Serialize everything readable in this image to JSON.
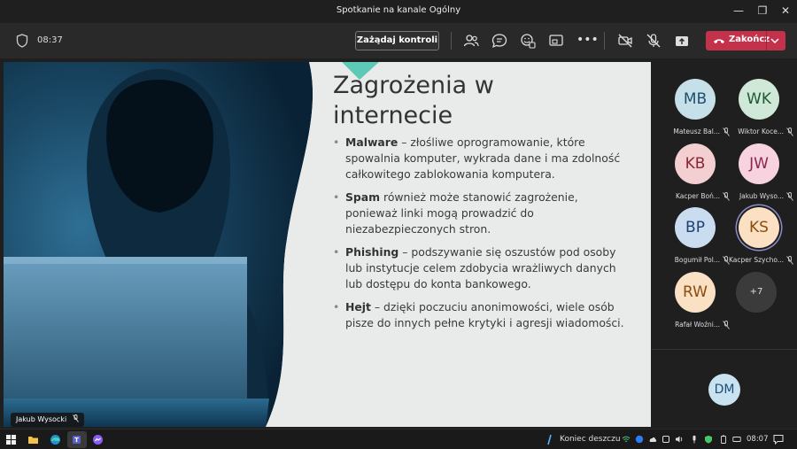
{
  "window": {
    "title": "Spotkanie na kanale Ogólny"
  },
  "toolbar": {
    "timer": "08:37",
    "request_control_label": "Zażądaj kontroli",
    "end_call_label": "Zakończ"
  },
  "slide": {
    "title_line1": "Zagrożenia w",
    "title_line2": "internecie",
    "bullets": [
      {
        "term": "Malware",
        "text": " – złośliwe oprogramowanie, które spowalnia komputer, wykrada dane i ma zdolność całkowitego zablokowania komputera."
      },
      {
        "term": "Spam",
        "text": " również może stanowić zagrożenie, ponieważ linki mogą prowadzić do niezabezpieczonych stron."
      },
      {
        "term": "Phishing",
        "text": " – podszywanie się oszustów pod osoby lub instytucje celem zdobycia wrażliwych danych lub dostępu do konta bankowego."
      },
      {
        "term": "Hejt",
        "text": " – dzięki poczuciu anonimowości, wiele osób pisze do innych pełne krytyki i agresji wiadomości."
      }
    ],
    "presenter_name": "Jakub Wysocki"
  },
  "participants": [
    {
      "initials": "MB",
      "name": "Mateusz Bal...",
      "bg": "#c6e0ea",
      "fg": "#1f4e6e"
    },
    {
      "initials": "WK",
      "name": "Wiktor Koce...",
      "bg": "#cfe8d8",
      "fg": "#1e5a36"
    },
    {
      "initials": "KB",
      "name": "Kacper Boń...",
      "bg": "#f4cfd2",
      "fg": "#8a2533"
    },
    {
      "initials": "JW",
      "name": "Jakub Wyso...",
      "bg": "#f7d2df",
      "fg": "#8c2750"
    },
    {
      "initials": "BP",
      "name": "Bogumił Pol...",
      "bg": "#c9dcf0",
      "fg": "#1d3f73"
    },
    {
      "initials": "KS",
      "name": "Kacper Szycho...",
      "bg": "#fbe0c4",
      "fg": "#8a4c11"
    },
    {
      "initials": "RW",
      "name": "Rafał Woźni...",
      "bg": "#fbe1c4",
      "fg": "#8a4c11"
    }
  ],
  "overflow_count": "+7",
  "waiting_participant": {
    "initials": "DM"
  },
  "taskbar": {
    "weather": "Koniec deszczu",
    "time": "08:07"
  },
  "colors": {
    "accent_end": "#c4314b",
    "teal": "#5fc9b8"
  }
}
